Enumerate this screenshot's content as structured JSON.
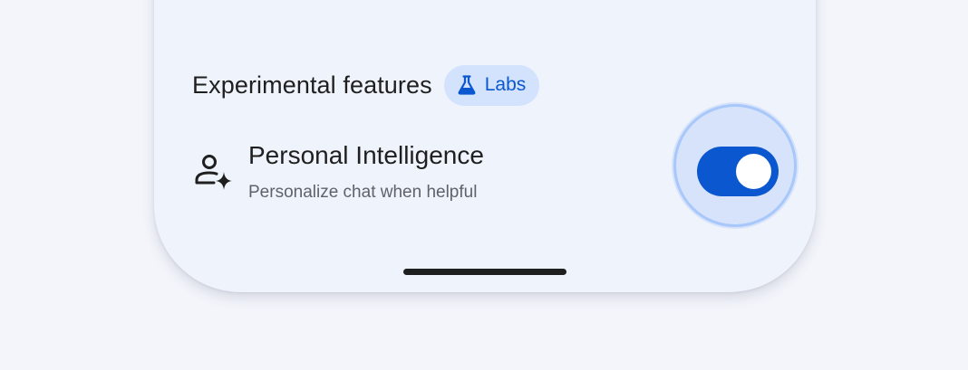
{
  "section": {
    "title": "Experimental features",
    "badge_label": "Labs",
    "badge_icon": "flask-icon"
  },
  "setting": {
    "icon": "person-sparkle-icon",
    "title": "Personal Intelligence",
    "subtitle": "Personalize chat when helpful",
    "toggle_on": true
  },
  "colors": {
    "background": "#f3f5fb",
    "card": "#eff3fb",
    "accent": "#0b57d0",
    "chip_bg": "#d3e3fd",
    "halo": "#a8c7fa",
    "text_primary": "#1f1f1f",
    "text_secondary": "#5f6368"
  }
}
